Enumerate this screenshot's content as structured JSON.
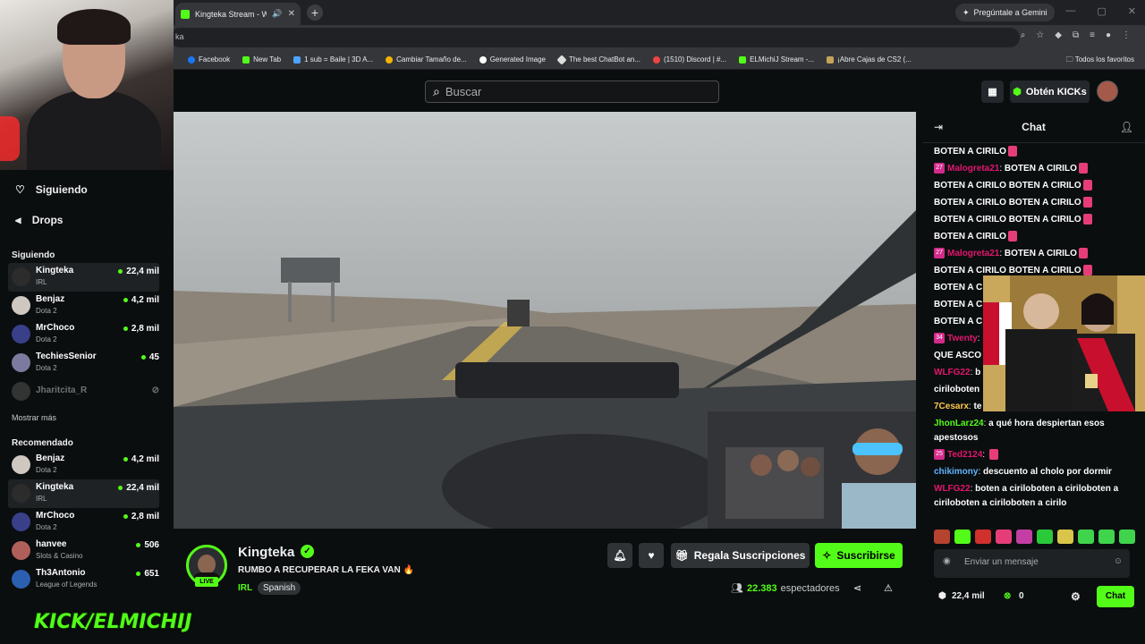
{
  "browser": {
    "tab_title": "Kingteka Stream - Watch Li...",
    "new_tab": "+",
    "gemini_label": "Pregúntale a Gemini",
    "url_fragment": "ka",
    "bookmarks": [
      "Facebook",
      "New Tab",
      "1 sub = Baile | 3D A...",
      "Cambiar Tamaño de...",
      "Generated Image",
      "The best ChatBot an...",
      "(1510) Discord | #...",
      "ELMichiJ Stream -...",
      "¡Abre Cajas de CS2 (..."
    ],
    "bookmarks_right": "Todos los favoritos"
  },
  "topnav": {
    "search_placeholder": "Buscar",
    "get_kicks": "Obtén KICKs"
  },
  "sidebar": {
    "following_main": "Siguiendo",
    "drops": "Drops",
    "following_heading": "Siguiendo",
    "following": [
      {
        "name": "Kingteka",
        "category": "IRL",
        "viewers": "22,4 mil",
        "live": true,
        "active": true,
        "color": "#2c2c2c"
      },
      {
        "name": "Benjaz",
        "category": "Dota 2",
        "viewers": "4,2 mil",
        "live": true,
        "active": false,
        "color": "#cfc8c0"
      },
      {
        "name": "MrChoco",
        "category": "Dota 2",
        "viewers": "2,8 mil",
        "live": true,
        "active": false,
        "color": "#3a3f8a"
      },
      {
        "name": "TechiesSenior",
        "category": "Dota 2",
        "viewers": "45",
        "live": true,
        "active": false,
        "color": "#7d7aa0"
      },
      {
        "name": "Jharitcita_R",
        "category": "",
        "viewers": "",
        "live": false,
        "active": false,
        "color": "#5a5a5a"
      }
    ],
    "show_more": "Mostrar más",
    "recommended_heading": "Recomendado",
    "recommended": [
      {
        "name": "Benjaz",
        "category": "Dota 2",
        "viewers": "4,2 mil",
        "active": false,
        "color": "#cfc8c0"
      },
      {
        "name": "Kingteka",
        "category": "IRL",
        "viewers": "22,4 mil",
        "active": true,
        "color": "#2c2c2c"
      },
      {
        "name": "MrChoco",
        "category": "Dota 2",
        "viewers": "2,8 mil",
        "active": false,
        "color": "#3a3f8a"
      },
      {
        "name": "hanvee",
        "category": "Slots & Casino",
        "viewers": "506",
        "active": false,
        "color": "#b0605a"
      },
      {
        "name": "Th3Antonio",
        "category": "League of Legends",
        "viewers": "651",
        "active": false,
        "color": "#2b5fb0"
      }
    ],
    "overlay_logo": "KICK/ELMICHIJ"
  },
  "stream": {
    "channel": "Kingteka",
    "live_badge": "LIVE",
    "title": "RUMBO A RECUPERAR LA FEKA VAN 🔥",
    "category": "IRL",
    "language": "Spanish",
    "gift_subs": "Regala Suscripciones",
    "subscribe": "Suscribirse",
    "viewers_count": "22.383",
    "viewers_label": "espectadores"
  },
  "chat": {
    "title": "Chat",
    "messages": [
      {
        "user": "",
        "badge": "",
        "color": "",
        "text": "BOTEN A CIRILO"
      },
      {
        "user": "Malogreta21",
        "badge": "27",
        "color": "#e2166e",
        "text": "BOTEN A CIRILO"
      },
      {
        "user": "",
        "badge": "",
        "color": "",
        "text": "BOTEN A CIRILO    BOTEN A CIRILO"
      },
      {
        "user": "",
        "badge": "",
        "color": "",
        "text": "BOTEN A CIRILO    BOTEN A CIRILO"
      },
      {
        "user": "",
        "badge": "",
        "color": "",
        "text": "BOTEN A CIRILO    BOTEN A CIRILO"
      },
      {
        "user": "",
        "badge": "",
        "color": "",
        "text": "BOTEN A CIRILO"
      },
      {
        "user": "Malogreta21",
        "badge": "27",
        "color": "#e2166e",
        "text": "BOTEN A CIRILO"
      },
      {
        "user": "",
        "badge": "",
        "color": "",
        "text": "BOTEN A CIRILO    BOTEN A CIRILO"
      },
      {
        "user": "",
        "badge": "",
        "color": "",
        "text": "BOTEN A C"
      },
      {
        "user": "",
        "badge": "",
        "color": "",
        "text": "BOTEN A C"
      },
      {
        "user": "",
        "badge": "",
        "color": "",
        "text": "BOTEN A C"
      },
      {
        "user": "Twenty",
        "badge": "34",
        "color": "#e2166e",
        "text": ""
      },
      {
        "user": "",
        "badge": "",
        "color": "",
        "text": "QUE ASCO"
      },
      {
        "user": "WLFG22",
        "badge": "",
        "color": "#e2166e",
        "text": "b"
      },
      {
        "user": "",
        "badge": "",
        "color": "",
        "text": "ciriloboten"
      },
      {
        "user": "7Cesarx",
        "badge": "",
        "color": "#ffc94d",
        "text": "te"
      },
      {
        "user": "JhonLarz24",
        "badge": "",
        "color": "#53fc18",
        "text": "a qué hora despiertan esos apestosos"
      },
      {
        "user": "Ted2124",
        "badge": "25",
        "color": "#e2166e",
        "text": ""
      },
      {
        "user": "chikimony",
        "badge": "",
        "color": "#5eb4ff",
        "text": "descuento al cholo por dormir"
      },
      {
        "user": "WLFG22",
        "badge": "",
        "color": "#e2166e",
        "text": "boten a ciriloboten a ciriloboten a ciriloboten a ciriloboten a cirilo"
      }
    ],
    "input_placeholder": "Enviar un mensaje",
    "kicks_balance": "22,4 mil",
    "points": "0",
    "send_button": "Chat"
  }
}
